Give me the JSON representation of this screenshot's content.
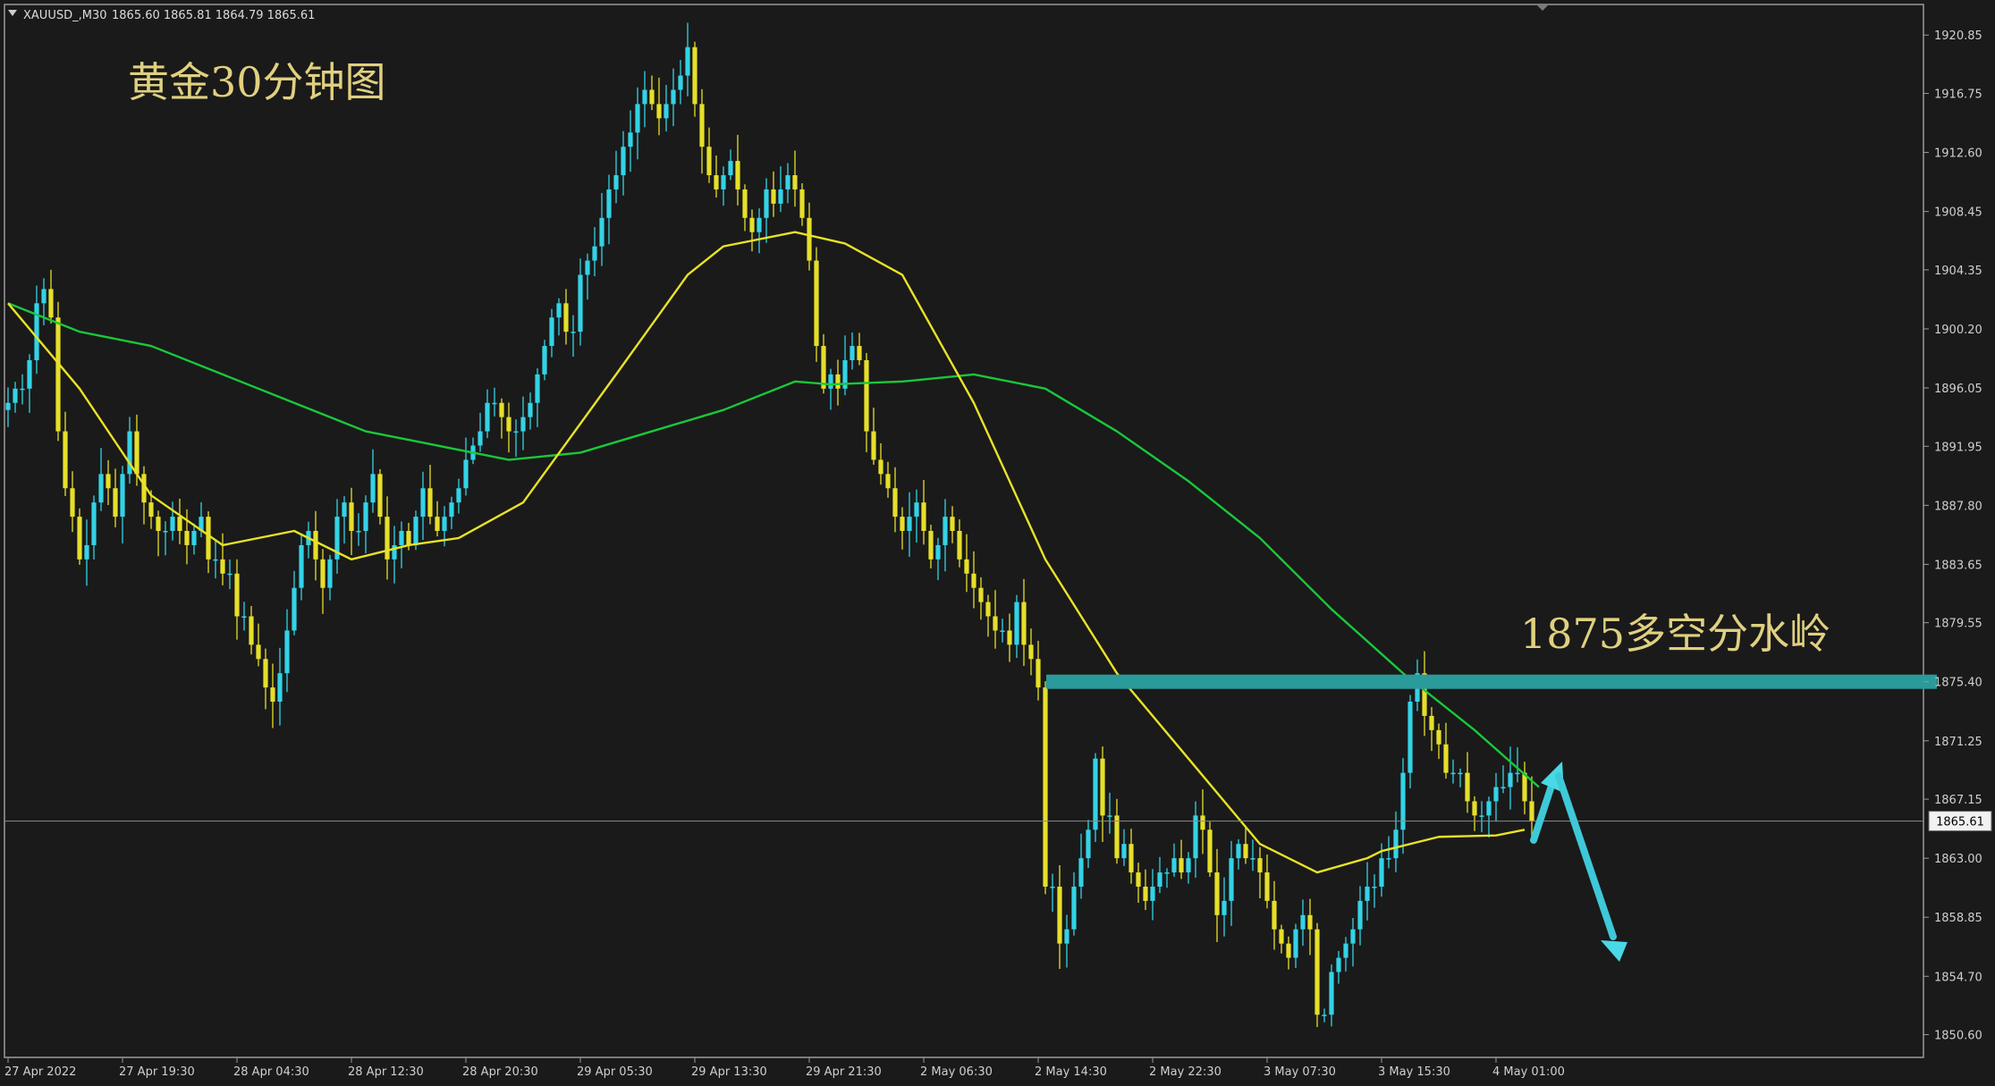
{
  "header": {
    "triangle_icon": "triangle-down-icon",
    "symbol": "XAUUSD_,M30",
    "ohlc": "1865.60 1865.81 1864.79 1865.61"
  },
  "annotations": {
    "title": "黄金30分钟图",
    "resistance_label": "1875多空分水岭"
  },
  "current_price_label": "1865.61",
  "colors": {
    "background": "#1a1a1a",
    "bull": "#33d3e6",
    "bear": "#e6df2a",
    "ma_fast": "#e8e227",
    "ma_slow": "#19c83a",
    "resistance": "#2a9a9a",
    "arrow": "#49d8e6",
    "text": "#e0d080",
    "axis_text": "#cfcfcf"
  },
  "chart_data": {
    "type": "candlestick",
    "symbol": "XAUUSD_",
    "timeframe": "M30",
    "ylim": [
      1849.0,
      1923.0
    ],
    "y_ticks": [
      1920.85,
      1916.75,
      1912.6,
      1908.45,
      1904.35,
      1900.2,
      1896.05,
      1891.95,
      1887.8,
      1883.65,
      1879.55,
      1875.4,
      1871.25,
      1867.15,
      1863.0,
      1858.85,
      1854.7,
      1850.6
    ],
    "x_ticks": [
      {
        "index": 0,
        "label": "27 Apr 2022"
      },
      {
        "index": 16,
        "label": "27 Apr 19:30"
      },
      {
        "index": 32,
        "label": "28 Apr 04:30"
      },
      {
        "index": 48,
        "label": "28 Apr 12:30"
      },
      {
        "index": 64,
        "label": "28 Apr 20:30"
      },
      {
        "index": 80,
        "label": "29 Apr 05:30"
      },
      {
        "index": 96,
        "label": "29 Apr 13:30"
      },
      {
        "index": 112,
        "label": "29 Apr 21:30"
      },
      {
        "index": 128,
        "label": "2 May 06:30"
      },
      {
        "index": 144,
        "label": "2 May 14:30"
      },
      {
        "index": 160,
        "label": "2 May 22:30"
      },
      {
        "index": 176,
        "label": "3 May 07:30"
      },
      {
        "index": 192,
        "label": "3 May 15:30"
      },
      {
        "index": 208,
        "label": "4 May 01:00"
      }
    ],
    "closes": [
      1895,
      1896,
      1896,
      1898,
      1902,
      1903,
      1901,
      1893,
      1889,
      1887,
      1884,
      1885,
      1888,
      1890,
      1889,
      1887,
      1890,
      1893,
      1890,
      1888,
      1887,
      1886,
      1886,
      1887,
      1886,
      1885,
      1886,
      1887,
      1884,
      1884,
      1883,
      1883,
      1880,
      1880,
      1878,
      1877,
      1875,
      1874,
      1876,
      1879,
      1882,
      1885,
      1886,
      1884,
      1882,
      1884,
      1887,
      1888,
      1886,
      1886,
      1888,
      1890,
      1887,
      1884,
      1885,
      1886,
      1885,
      1887,
      1889,
      1887,
      1886,
      1887,
      1888,
      1889,
      1891,
      1892,
      1893,
      1895,
      1895,
      1894,
      1893,
      1893,
      1894,
      1895,
      1897,
      1899,
      1901,
      1902,
      1900,
      1900,
      1904,
      1905,
      1906,
      1908,
      1910,
      1911,
      1913,
      1914,
      1916,
      1917,
      1916,
      1915,
      1916,
      1917,
      1918,
      1920,
      1916,
      1913,
      1911,
      1910,
      1911,
      1912,
      1910,
      1908,
      1907,
      1908,
      1910,
      1909,
      1910,
      1911,
      1910,
      1908,
      1905,
      1899,
      1896,
      1897,
      1896,
      1898,
      1899,
      1898,
      1893,
      1891,
      1890,
      1889,
      1887,
      1886,
      1887,
      1888,
      1886,
      1884,
      1885,
      1887,
      1886,
      1884,
      1883,
      1882,
      1881,
      1880,
      1879,
      1879,
      1878,
      1881,
      1878,
      1877,
      1875,
      1861,
      1861,
      1857,
      1858,
      1861,
      1863,
      1865,
      1870,
      1866,
      1866,
      1863,
      1864,
      1862,
      1861,
      1860,
      1861,
      1862,
      1862,
      1863,
      1862,
      1863,
      1866,
      1865,
      1862,
      1859,
      1860,
      1863,
      1864,
      1863,
      1863,
      1862,
      1860,
      1858,
      1857,
      1856,
      1858,
      1859,
      1858,
      1852,
      1852,
      1855,
      1856,
      1857,
      1858,
      1860,
      1861,
      1861,
      1863,
      1863,
      1865,
      1869,
      1874,
      1876,
      1873,
      1872,
      1871,
      1869,
      1869,
      1869,
      1867,
      1866,
      1866,
      1867,
      1868,
      1868,
      1869,
      1869,
      1867,
      1865.61
    ],
    "ma_fast": {
      "x": [
        0,
        10,
        20,
        30,
        40,
        48,
        56,
        63,
        72,
        85,
        95,
        100,
        110,
        117,
        125,
        135,
        145,
        155,
        165,
        175,
        183,
        190,
        192,
        200,
        208,
        212
      ],
      "y": [
        1902,
        1896,
        1888.5,
        1885,
        1886,
        1884,
        1885,
        1885.5,
        1888,
        1897,
        1904,
        1906,
        1907,
        1906.2,
        1904,
        1895,
        1884,
        1876,
        1870,
        1864,
        1862,
        1863,
        1863.5,
        1864.5,
        1864.6,
        1865
      ]
    },
    "ma_slow": {
      "x": [
        0,
        10,
        20,
        30,
        40,
        50,
        60,
        70,
        80,
        90,
        100,
        110,
        115,
        125,
        135,
        145,
        155,
        165,
        175,
        185,
        195,
        205,
        214
      ],
      "y": [
        1902,
        1900,
        1899,
        1897,
        1895,
        1893,
        1892,
        1891,
        1891.5,
        1893,
        1894.5,
        1896.5,
        1896.3,
        1896.5,
        1897,
        1896,
        1893,
        1889.5,
        1885.5,
        1880.5,
        1876,
        1872,
        1868
      ]
    },
    "resistance_level": 1875.4,
    "current_price": 1865.61
  }
}
